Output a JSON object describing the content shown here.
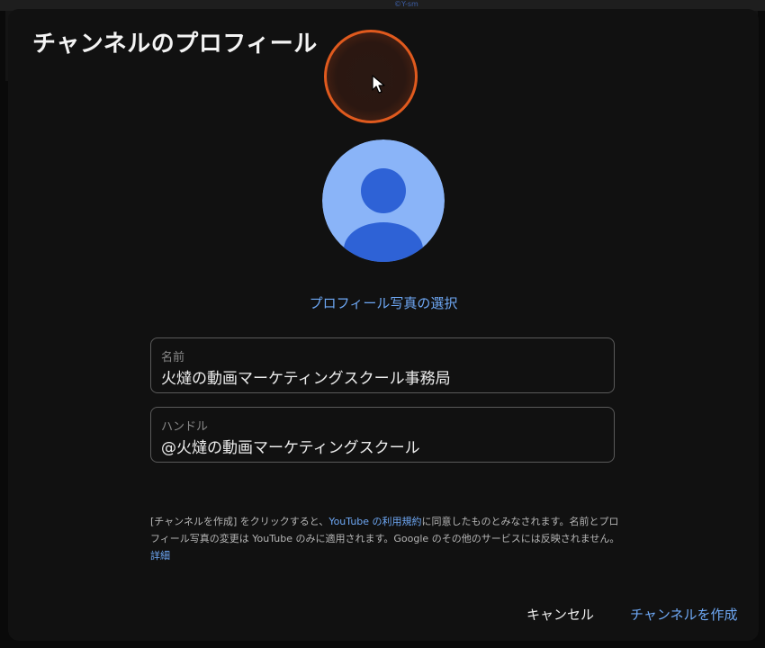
{
  "topstrip": {
    "text": "©Y-sm"
  },
  "dialog": {
    "title": "チャンネルのプロフィール",
    "select_photo_label": "プロフィール写真の選択"
  },
  "name_field": {
    "label": "名前",
    "value": "火燵の動画マーケティングスクール事務局"
  },
  "handle_field": {
    "label": "ハンドル",
    "value": "@火燵の動画マーケティングスクール"
  },
  "terms": {
    "part1": "[チャンネルを作成] をクリックすると、",
    "link_terms": "YouTube の利用規約",
    "part2": "に同意したものとみなされます。名前とプロフィール写真の変更は YouTube のみに適用されます。Google のその他のサービスには反映されません。",
    "link_details": "詳細"
  },
  "buttons": {
    "cancel": "キャンセル",
    "create": "チャンネルを作成"
  },
  "colors": {
    "accent_link": "#6ea8f5",
    "avatar_bg": "#8ab4f8",
    "avatar_figure": "#2e62d6",
    "click_highlight": "#e05a1e"
  },
  "icons": {
    "avatar": "default-person-avatar-icon",
    "cursor": "mouse-pointer-icon"
  }
}
